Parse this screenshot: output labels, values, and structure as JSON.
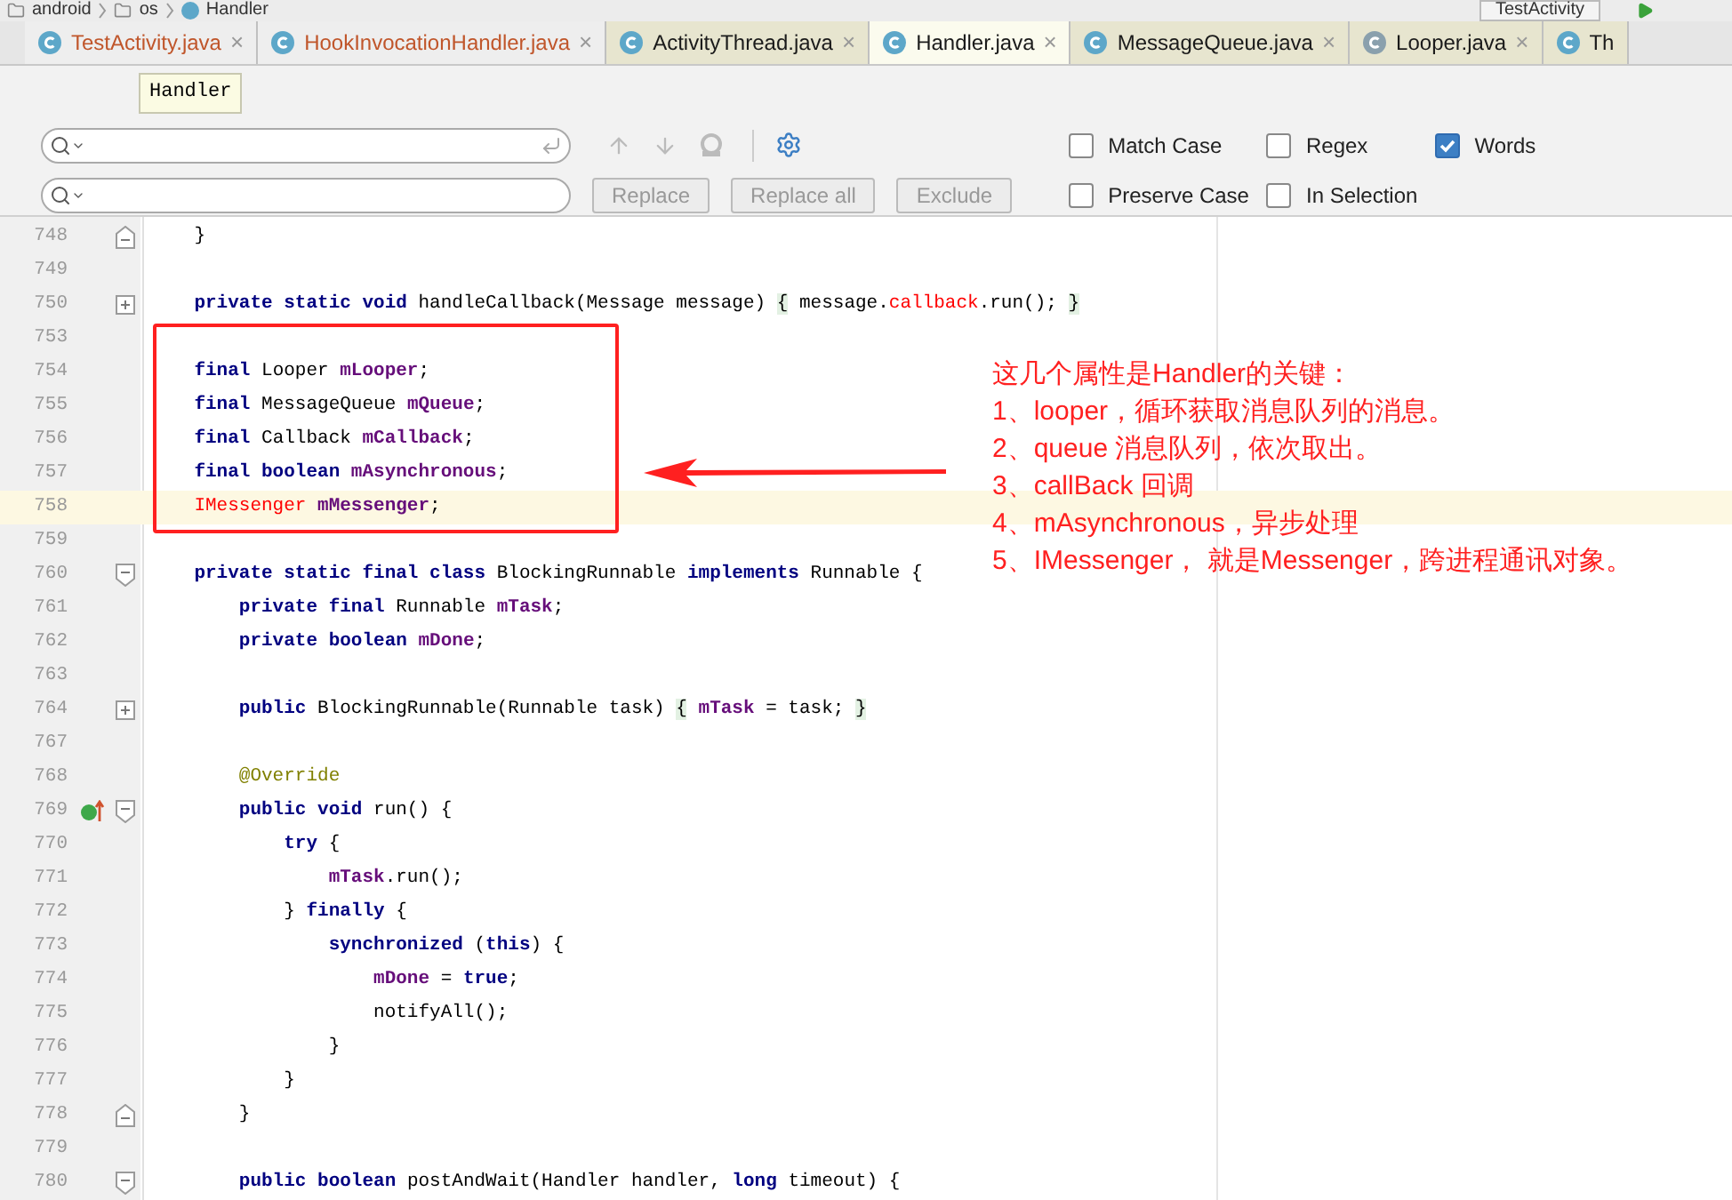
{
  "breadcrumbs": [
    {
      "label": "android",
      "kind": "folder"
    },
    {
      "label": "os",
      "kind": "folder"
    },
    {
      "label": "Handler",
      "kind": "class"
    }
  ],
  "run_config": "TestActivity",
  "tabs": [
    {
      "label": "TestActivity.java",
      "selected": false,
      "library": false,
      "color": "#c0562b",
      "close": "×"
    },
    {
      "label": "HookInvocationHandler.java",
      "selected": false,
      "library": false,
      "color": "#c0562b",
      "close": "×"
    },
    {
      "label": "ActivityThread.java",
      "selected": false,
      "library": true,
      "color": "#1a1a1a",
      "close": "×"
    },
    {
      "label": "Handler.java",
      "selected": true,
      "library": true,
      "color": "#1a1a1a",
      "close": "×"
    },
    {
      "label": "MessageQueue.java",
      "selected": false,
      "library": true,
      "color": "#1a1a1a",
      "close": "×"
    },
    {
      "label": "Looper.java",
      "selected": false,
      "library": true,
      "color": "#1a1a1a",
      "close": "×"
    },
    {
      "label": "Th",
      "selected": false,
      "library": true,
      "color": "#1a1a1a"
    }
  ],
  "tooltip": "Handler",
  "find_bar": {
    "buttons": [
      {
        "label": "Replace",
        "disabled": true
      },
      {
        "label": "Replace all",
        "disabled": true
      },
      {
        "label": "Exclude",
        "disabled": true
      }
    ],
    "options": [
      {
        "label": "Match Case",
        "checked": false
      },
      {
        "label": "Regex",
        "checked": false
      },
      {
        "label": "Words",
        "checked": true
      },
      {
        "label": "Preserve Case",
        "checked": false
      },
      {
        "label": "In Selection",
        "checked": false
      }
    ]
  },
  "code_lines": [
    {
      "number": "748",
      "kind": "fold_end",
      "overrides": false,
      "highlighted": false,
      "tokens": [
        {
          "kind": "plain",
          "text": "    }"
        }
      ]
    },
    {
      "number": "749",
      "kind": "plain",
      "overrides": false,
      "highlighted": false
    },
    {
      "number": "750",
      "kind": "fold_collapsed",
      "overrides": false,
      "highlighted": false,
      "tokens": [
        {
          "kind": "keyword",
          "text": "    private static void "
        },
        {
          "kind": "plain",
          "text": "handleCallback(Message message) "
        },
        {
          "kind": "folded",
          "text": "{"
        },
        {
          "kind": "plain",
          "text": " message."
        },
        {
          "kind": "error",
          "text": "callback"
        },
        {
          "kind": "plain",
          "text": ".run(); "
        },
        {
          "kind": "folded",
          "text": "}"
        }
      ]
    },
    {
      "number": "753",
      "kind": "plain",
      "overrides": false,
      "highlighted": false
    },
    {
      "number": "754",
      "kind": "plain",
      "overrides": false,
      "highlighted": false,
      "tokens": [
        {
          "kind": "keyword",
          "text": "    final "
        },
        {
          "kind": "plain",
          "text": "Looper "
        },
        {
          "kind": "field",
          "text": "mLooper"
        },
        {
          "kind": "plain",
          "text": ";"
        }
      ]
    },
    {
      "number": "755",
      "kind": "plain",
      "overrides": false,
      "highlighted": false,
      "tokens": [
        {
          "kind": "keyword",
          "text": "    final "
        },
        {
          "kind": "plain",
          "text": "MessageQueue "
        },
        {
          "kind": "field",
          "text": "mQueue"
        },
        {
          "kind": "plain",
          "text": ";"
        }
      ]
    },
    {
      "number": "756",
      "kind": "plain",
      "overrides": false,
      "highlighted": false,
      "tokens": [
        {
          "kind": "keyword",
          "text": "    final "
        },
        {
          "kind": "plain",
          "text": "Callback "
        },
        {
          "kind": "field",
          "text": "mCallback"
        },
        {
          "kind": "plain",
          "text": ";"
        }
      ]
    },
    {
      "number": "757",
      "kind": "plain",
      "overrides": false,
      "highlighted": false,
      "tokens": [
        {
          "kind": "keyword",
          "text": "    final boolean "
        },
        {
          "kind": "field",
          "text": "mAsynchronous"
        },
        {
          "kind": "plain",
          "text": ";"
        }
      ]
    },
    {
      "number": "758",
      "kind": "plain",
      "overrides": false,
      "highlighted": true,
      "tokens": [
        {
          "kind": "error",
          "text": "    IMessenger "
        },
        {
          "kind": "field",
          "text": "mMessenger"
        },
        {
          "kind": "plain",
          "text": ";"
        }
      ]
    },
    {
      "number": "759",
      "kind": "plain",
      "overrides": false,
      "highlighted": false
    },
    {
      "number": "760",
      "kind": "fold_start",
      "overrides": false,
      "highlighted": false,
      "tokens": [
        {
          "kind": "keyword",
          "text": "    private static final class "
        },
        {
          "kind": "plain",
          "text": "BlockingRunnable "
        },
        {
          "kind": "keyword",
          "text": "implements "
        },
        {
          "kind": "plain",
          "text": "Runnable {"
        }
      ]
    },
    {
      "number": "761",
      "kind": "plain",
      "overrides": false,
      "highlighted": false,
      "tokens": [
        {
          "kind": "keyword",
          "text": "        private final "
        },
        {
          "kind": "plain",
          "text": "Runnable "
        },
        {
          "kind": "field",
          "text": "mTask"
        },
        {
          "kind": "plain",
          "text": ";"
        }
      ]
    },
    {
      "number": "762",
      "kind": "plain",
      "overrides": false,
      "highlighted": false,
      "tokens": [
        {
          "kind": "keyword",
          "text": "        private boolean "
        },
        {
          "kind": "field",
          "text": "mDone"
        },
        {
          "kind": "plain",
          "text": ";"
        }
      ]
    },
    {
      "number": "763",
      "kind": "plain",
      "overrides": false,
      "highlighted": false
    },
    {
      "number": "764",
      "kind": "fold_collapsed",
      "overrides": false,
      "highlighted": false,
      "tokens": [
        {
          "kind": "keyword",
          "text": "        public "
        },
        {
          "kind": "plain",
          "text": "BlockingRunnable(Runnable task) "
        },
        {
          "kind": "folded",
          "text": "{"
        },
        {
          "kind": "field",
          "text": " mTask"
        },
        {
          "kind": "plain",
          "text": " = task; "
        },
        {
          "kind": "folded",
          "text": "}"
        }
      ]
    },
    {
      "number": "767",
      "kind": "plain",
      "overrides": false,
      "highlighted": false
    },
    {
      "number": "768",
      "kind": "plain",
      "overrides": false,
      "highlighted": false,
      "tokens": [
        {
          "kind": "annotation",
          "text": "        @Override"
        }
      ]
    },
    {
      "number": "769",
      "kind": "fold_start",
      "overrides": true,
      "highlighted": false,
      "tokens": [
        {
          "kind": "keyword",
          "text": "        public void "
        },
        {
          "kind": "plain",
          "text": "run() {"
        }
      ]
    },
    {
      "number": "770",
      "kind": "plain",
      "overrides": false,
      "highlighted": false,
      "tokens": [
        {
          "kind": "keyword",
          "text": "            try "
        },
        {
          "kind": "plain",
          "text": "{"
        }
      ]
    },
    {
      "number": "771",
      "kind": "plain",
      "overrides": false,
      "highlighted": false,
      "tokens": [
        {
          "kind": "field",
          "text": "                mTask"
        },
        {
          "kind": "plain",
          "text": ".run();"
        }
      ]
    },
    {
      "number": "772",
      "kind": "plain",
      "overrides": false,
      "highlighted": false,
      "tokens": [
        {
          "kind": "plain",
          "text": "            } "
        },
        {
          "kind": "keyword",
          "text": "finally "
        },
        {
          "kind": "plain",
          "text": "{"
        }
      ]
    },
    {
      "number": "773",
      "kind": "plain",
      "overrides": false,
      "highlighted": false,
      "tokens": [
        {
          "kind": "keyword",
          "text": "                synchronized "
        },
        {
          "kind": "plain",
          "text": "("
        },
        {
          "kind": "keyword",
          "text": "this"
        },
        {
          "kind": "plain",
          "text": ") {"
        }
      ]
    },
    {
      "number": "774",
      "kind": "plain",
      "overrides": false,
      "highlighted": false,
      "tokens": [
        {
          "kind": "field",
          "text": "                    mDone"
        },
        {
          "kind": "plain",
          "text": " = "
        },
        {
          "kind": "keyword",
          "text": "true"
        },
        {
          "kind": "plain",
          "text": ";"
        }
      ]
    },
    {
      "number": "775",
      "kind": "plain",
      "overrides": false,
      "highlighted": false,
      "tokens": [
        {
          "kind": "plain",
          "text": "                    notifyAll();"
        }
      ]
    },
    {
      "number": "776",
      "kind": "plain",
      "overrides": false,
      "highlighted": false,
      "tokens": [
        {
          "kind": "plain",
          "text": "                }"
        }
      ]
    },
    {
      "number": "777",
      "kind": "plain",
      "overrides": false,
      "highlighted": false,
      "tokens": [
        {
          "kind": "plain",
          "text": "            }"
        }
      ]
    },
    {
      "number": "778",
      "kind": "fold_end",
      "overrides": false,
      "highlighted": false,
      "tokens": [
        {
          "kind": "plain",
          "text": "        }"
        }
      ]
    },
    {
      "number": "779",
      "kind": "plain",
      "overrides": false,
      "highlighted": false
    },
    {
      "number": "780",
      "kind": "fold_start",
      "overrides": false,
      "highlighted": false,
      "tokens": [
        {
          "kind": "keyword",
          "text": "        public boolean "
        },
        {
          "kind": "plain",
          "text": "postAndWait(Handler handler, "
        },
        {
          "kind": "keyword",
          "text": "long "
        },
        {
          "kind": "plain",
          "text": "timeout) {"
        }
      ]
    }
  ],
  "annotation": {
    "title": "这几个属性是Handler的关键：",
    "lines": [
      "1、looper，循环获取消息队列的消息。",
      "2、queue 消息队列，依次取出。",
      "3、callBack 回调",
      "4、mAsynchronous，异步处理",
      "5、IMessenger， 就是Messenger，跨进程通讯对象。"
    ]
  }
}
